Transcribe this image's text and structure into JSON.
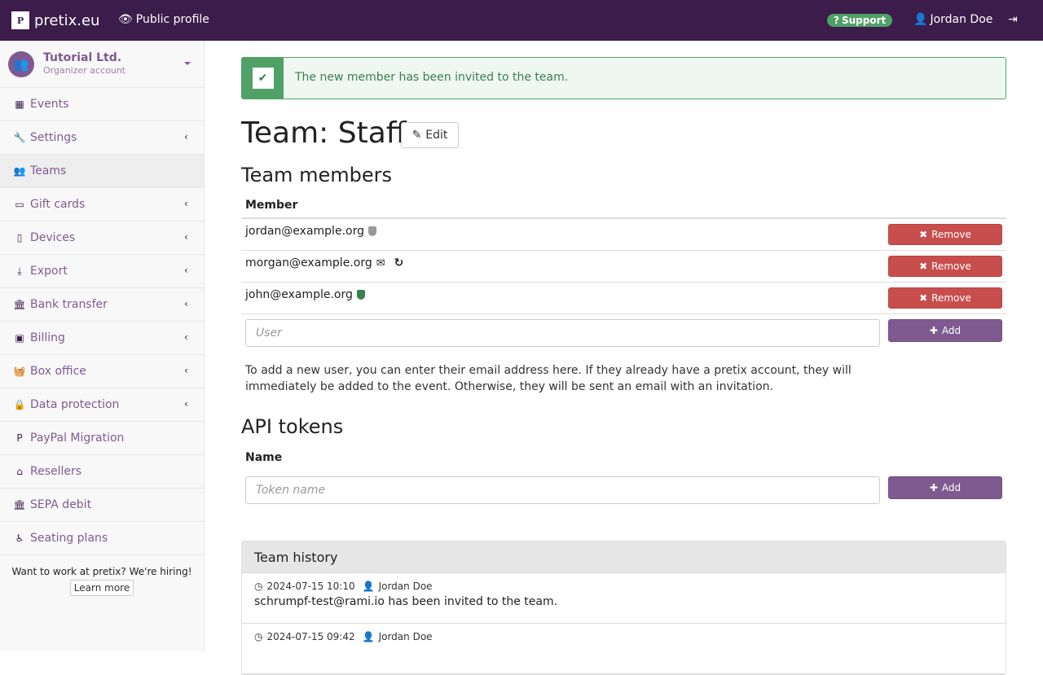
{
  "topbar": {
    "brand": "pretix.eu",
    "brand_logo": "P",
    "public_profile": "Public profile",
    "support": "Support",
    "user": "Jordan Doe"
  },
  "sidebar": {
    "org_name": "Tutorial Ltd.",
    "org_type": "Organizer account",
    "items": [
      {
        "label": "Events",
        "icon": "calendar-icon",
        "glyph": "▦",
        "chevron": false,
        "active": false
      },
      {
        "label": "Settings",
        "icon": "wrench-icon",
        "glyph": "🔧",
        "chevron": true,
        "active": false
      },
      {
        "label": "Teams",
        "icon": "users-icon",
        "glyph": "👥",
        "chevron": false,
        "active": true
      },
      {
        "label": "Gift cards",
        "icon": "credit-card-icon",
        "glyph": "▭",
        "chevron": true,
        "active": false
      },
      {
        "label": "Devices",
        "icon": "tablet-icon",
        "glyph": "▯",
        "chevron": true,
        "active": false
      },
      {
        "label": "Export",
        "icon": "download-icon",
        "glyph": "⤓",
        "chevron": true,
        "active": false
      },
      {
        "label": "Bank transfer",
        "icon": "bank-icon",
        "glyph": "🏛",
        "chevron": true,
        "active": false
      },
      {
        "label": "Billing",
        "icon": "money-icon",
        "glyph": "▣",
        "chevron": true,
        "active": false
      },
      {
        "label": "Box office",
        "icon": "basket-icon",
        "glyph": "🧺",
        "chevron": true,
        "active": false
      },
      {
        "label": "Data protection",
        "icon": "lock-icon",
        "glyph": "🔒",
        "chevron": true,
        "active": false
      },
      {
        "label": "PayPal Migration",
        "icon": "paypal-icon",
        "glyph": "P",
        "chevron": false,
        "active": false
      },
      {
        "label": "Resellers",
        "icon": "home-icon",
        "glyph": "⌂",
        "chevron": false,
        "active": false
      },
      {
        "label": "SEPA debit",
        "icon": "bank-icon",
        "glyph": "🏛",
        "chevron": false,
        "active": false
      },
      {
        "label": "Seating plans",
        "icon": "wheelchair-icon",
        "glyph": "♿",
        "chevron": false,
        "active": false
      }
    ],
    "hiring_text": "Want to work at pretix? We're hiring!",
    "learn_more": "Learn more"
  },
  "alert": {
    "message": "The new member has been invited to the team."
  },
  "page": {
    "title": "Team: Staff",
    "edit": "Edit",
    "members_heading": "Team members",
    "member_col": "Member",
    "members": [
      {
        "email": "jordan@example.org",
        "badge": "shield-grey"
      },
      {
        "email": "morgan@example.org",
        "badge": "invited"
      },
      {
        "email": "john@example.org",
        "badge": "shield-green"
      }
    ],
    "remove_label": "Remove",
    "user_placeholder": "User",
    "add_label": "Add",
    "help_text": "To add a new user, you can enter their email address here. If they already have a pretix account, they will immediately be added to the event. Otherwise, they will be sent an email with an invitation.",
    "api_heading": "API tokens",
    "name_col": "Name",
    "token_placeholder": "Token name"
  },
  "history": {
    "heading": "Team history",
    "entries": [
      {
        "time": "2024-07-15 10:10",
        "user": "Jordan Doe",
        "text": "schrumpf-test@rami.io has been invited to the team."
      },
      {
        "time": "2024-07-15 09:42",
        "user": "Jordan Doe",
        "text": ""
      }
    ]
  },
  "colors": {
    "brand": "#3b1c4a",
    "accent": "#7f5a91",
    "success": "#50a167",
    "danger": "#c84e4e"
  }
}
